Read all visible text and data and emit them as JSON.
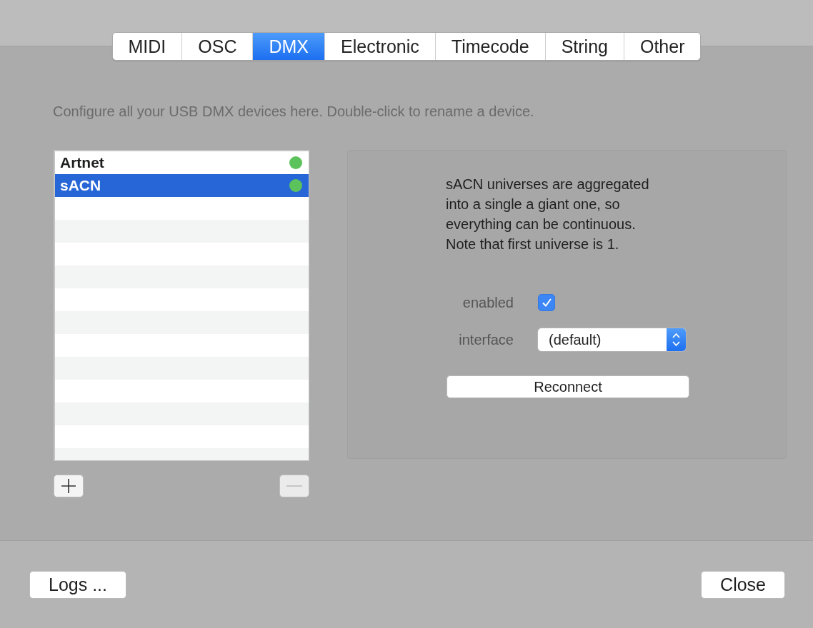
{
  "tabs": [
    {
      "label": "MIDI",
      "selected": false
    },
    {
      "label": "OSC",
      "selected": false
    },
    {
      "label": "DMX",
      "selected": true
    },
    {
      "label": "Electronic",
      "selected": false
    },
    {
      "label": "Timecode",
      "selected": false
    },
    {
      "label": "String",
      "selected": false
    },
    {
      "label": "Other",
      "selected": false
    }
  ],
  "description": "Configure all your USB DMX devices here. Double-click to rename a device.",
  "devices": [
    {
      "name": "Artnet",
      "selected": false,
      "color": "#5cc25c"
    },
    {
      "name": "sACN",
      "selected": true,
      "color": "#5cc25c"
    }
  ],
  "list_controls": [
    {
      "kind": "add",
      "disabled": false
    },
    {
      "kind": "remove",
      "disabled": true
    }
  ],
  "detail": {
    "info": "sACN universes are aggregated into a single a giant one, so everything can be continuous. Note that first universe is 1.",
    "fields": [
      {
        "kind": "checkbox",
        "label": "enabled",
        "checked": true
      },
      {
        "kind": "popup",
        "label": "interface",
        "value": "(default)"
      }
    ],
    "action": "Reconnect"
  },
  "footer": {
    "left_button": "Logs ...",
    "right_button": "Close"
  }
}
